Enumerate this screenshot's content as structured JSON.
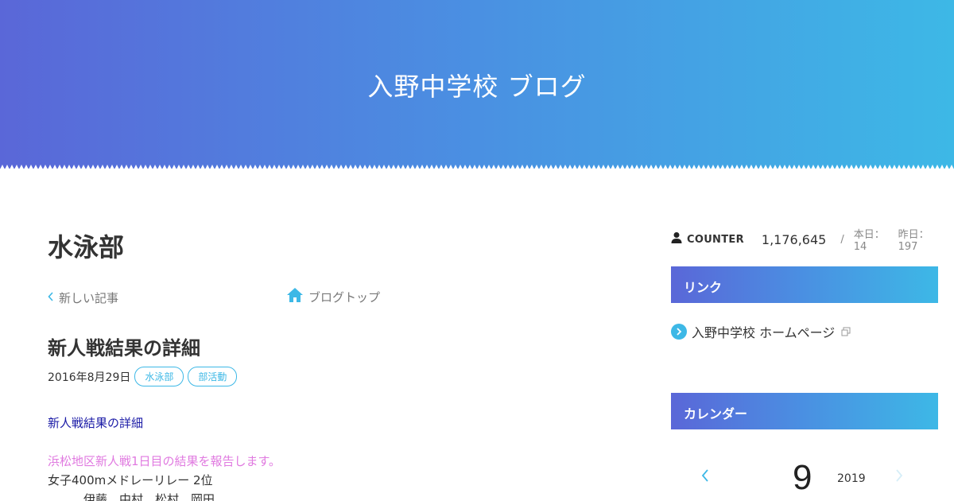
{
  "header": {
    "title": "入野中学校 ブログ"
  },
  "main": {
    "category_title": "水泳部",
    "nav": {
      "prev_label": "新しい記事",
      "top_label": "ブログトップ"
    },
    "post": {
      "title": "新人戦結果の詳細",
      "date": "2016年8月29日",
      "tags": [
        "水泳部",
        "部活動"
      ],
      "body": [
        "新人戦結果の詳細",
        "浜松地区新人戦1日目の結果を報告します。",
        "女子400mメドレーリレー 2位",
        "伊藤　中村　松村　岡田"
      ]
    }
  },
  "sidebar": {
    "counter": {
      "label": "COUNTER",
      "total": "1,176,645",
      "separator": "/",
      "today": "本日：14",
      "yesterday": "昨日：197"
    },
    "links_widget": {
      "title": "リンク",
      "items": [
        {
          "label": "入野中学校 ホームページ"
        }
      ]
    },
    "calendar_widget": {
      "title": "カレンダー",
      "month": "9",
      "year": "2019"
    }
  },
  "colors": {
    "gradient_start": "#5a67d8",
    "gradient_end": "#3db8e6",
    "accent": "#3db8e6",
    "body_blue": "#1a1aa6",
    "body_pink": "#e07ae0"
  }
}
